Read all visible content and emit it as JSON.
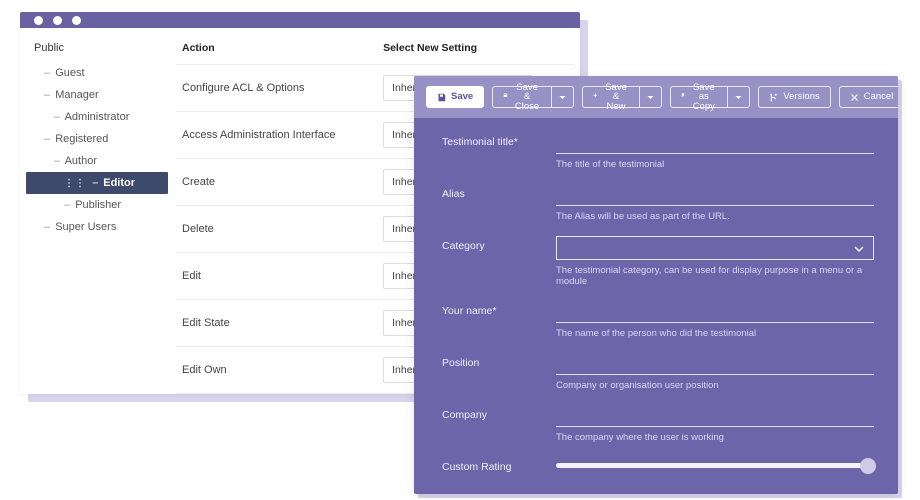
{
  "sidebar": {
    "root": "Public",
    "items": [
      {
        "label": "Guest",
        "level": 1,
        "active": false
      },
      {
        "label": "Manager",
        "level": 1,
        "active": false
      },
      {
        "label": "Administrator",
        "level": 2,
        "active": false
      },
      {
        "label": "Registered",
        "level": 1,
        "active": false
      },
      {
        "label": "Author",
        "level": 2,
        "active": false
      },
      {
        "label": "Editor",
        "level": 3,
        "active": true
      },
      {
        "label": "Publisher",
        "level": 3,
        "active": false
      },
      {
        "label": "Super Users",
        "level": 1,
        "active": false
      }
    ]
  },
  "perm_table": {
    "headers": {
      "action": "Action",
      "setting": "Select New Setting"
    },
    "rows": [
      {
        "action": "Configure ACL & Options",
        "setting": "Inherited"
      },
      {
        "action": "Access Administration Interface",
        "setting": "Inherited"
      },
      {
        "action": "Create",
        "setting": "Inherited"
      },
      {
        "action": "Delete",
        "setting": "Inherited"
      },
      {
        "action": "Edit",
        "setting": "Inherited"
      },
      {
        "action": "Edit State",
        "setting": "Inherited"
      },
      {
        "action": "Edit Own",
        "setting": "Inherited"
      }
    ]
  },
  "toolbar": {
    "save": "Save",
    "save_close": "Save & Close",
    "save_new": "Save & New",
    "save_copy": "Save as Copy",
    "versions": "Versions",
    "cancel": "Cancel"
  },
  "form": {
    "title": {
      "label": "Testimonial title*",
      "helper": "The title of the testimonial"
    },
    "alias": {
      "label": "Alias",
      "helper": "The Alias will be used as part of the URL."
    },
    "category": {
      "label": "Category",
      "helper": "The testimonial category, can be used for display purpose in a menu or a module"
    },
    "name": {
      "label": "Your name*",
      "helper": "The name of the person who did the testimonial"
    },
    "position": {
      "label": "Position",
      "helper": "Company or organisation user position"
    },
    "company": {
      "label": "Company",
      "helper": "The company where the user is working"
    },
    "rating": {
      "label": "Custom Rating"
    }
  }
}
